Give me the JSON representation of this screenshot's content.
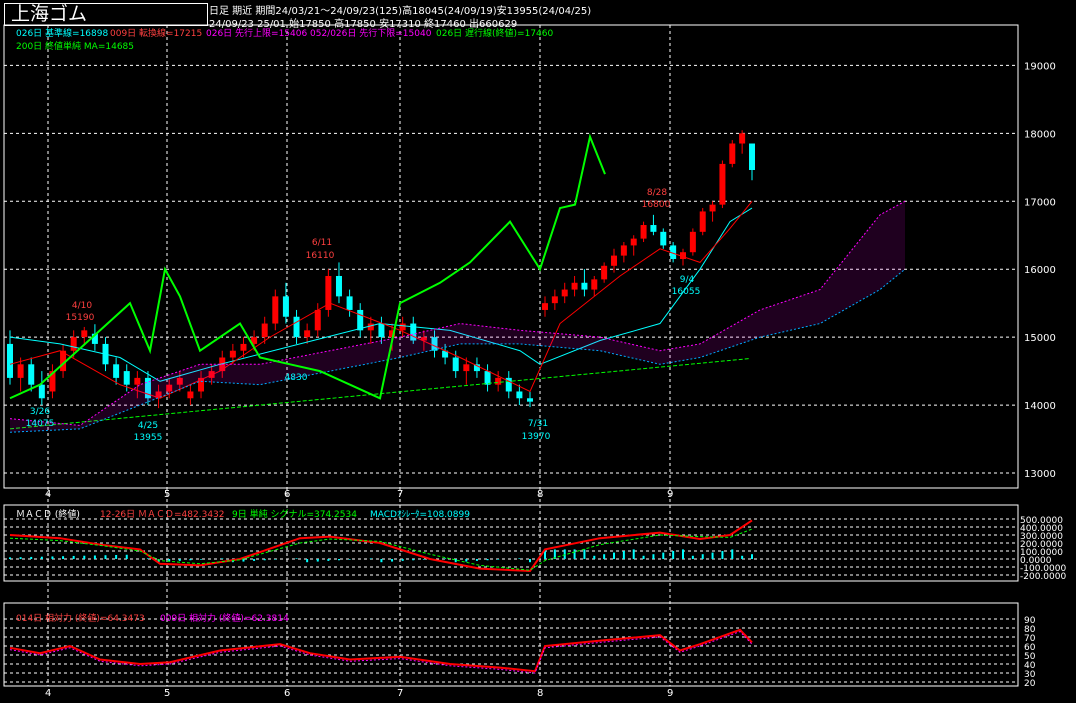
{
  "header": {
    "title": "上海ゴム",
    "line1": "日足  期近  期間24/03/21～24/09/23(125)高18045(24/09/19)安13955(24/04/25)",
    "line2": "24/09/23 25/01 始17850 高17850 安17310 終17460 出660629"
  },
  "legend": {
    "kijun": "026日 基準線=16898",
    "tenkan": "009日 転換線=17215",
    "senkou_a": "026日 先行上限=15406",
    "senkou_b": "052/026日 先行下限=15040",
    "chikou": "026日 遅行線(終値)=17460",
    "ma200": "200日 終値単純 MA=14685"
  },
  "macd_legend": {
    "title": "ＭＡＣＤ (終値)",
    "macd": "12-26日 ＭＡＣＤ=482.3432",
    "signal": "9日 単純 シグナル=374.2534",
    "osc": "MACDｵｼﾚｰﾀ=108.0899"
  },
  "rsi_legend": {
    "rsi14": "014日 相対力 (終値)=64.3473",
    "rsi9": "009日 相対力 (終値)=62.3814"
  },
  "colors": {
    "up": "#ff0000",
    "down": "#00ffff",
    "kijun": "#00ffff",
    "tenkan": "#ff0000",
    "chikou": "#00ff00",
    "ma200": "#00ff00",
    "cloud": "#ff00ff",
    "grid": "#ffffff"
  },
  "chart_data": [
    {
      "type": "candlestick",
      "ylim": [
        13000,
        19300
      ],
      "yticks": [
        13000,
        14000,
        15000,
        16000,
        17000,
        18000,
        19000
      ],
      "month_labels": [
        "4",
        "5",
        "6",
        "7",
        "8",
        "9"
      ],
      "candles": [
        [
          14900,
          15100,
          14300,
          14400
        ],
        [
          14400,
          14700,
          14200,
          14600
        ],
        [
          14600,
          14700,
          14200,
          14300
        ],
        [
          14300,
          14500,
          14000,
          14100
        ],
        [
          14200,
          14600,
          14100,
          14500
        ],
        [
          14500,
          14900,
          14400,
          14800
        ],
        [
          14800,
          15100,
          14700,
          15000
        ],
        [
          15000,
          15150,
          14900,
          15100
        ],
        [
          15050,
          15190,
          14800,
          14900
        ],
        [
          14900,
          15000,
          14500,
          14600
        ],
        [
          14600,
          14700,
          14300,
          14400
        ],
        [
          14500,
          14600,
          14200,
          14300
        ],
        [
          14300,
          14500,
          14100,
          14400
        ],
        [
          14400,
          14500,
          14000,
          14100
        ],
        [
          14100,
          14300,
          13955,
          14200
        ],
        [
          14200,
          14400,
          14100,
          14300
        ],
        [
          14300,
          14500,
          14200,
          14400
        ],
        [
          14100,
          14300,
          14000,
          14200
        ],
        [
          14200,
          14500,
          14100,
          14400
        ],
        [
          14400,
          14600,
          14300,
          14500
        ],
        [
          14500,
          14800,
          14400,
          14700
        ],
        [
          14700,
          14900,
          14600,
          14800
        ],
        [
          14800,
          15000,
          14700,
          14900
        ],
        [
          14900,
          15100,
          14800,
          15000
        ],
        [
          15000,
          15300,
          14900,
          15200
        ],
        [
          15200,
          15700,
          15100,
          15600
        ],
        [
          15600,
          15800,
          15200,
          15300
        ],
        [
          15300,
          15400,
          14900,
          15000
        ],
        [
          15000,
          15200,
          14900,
          15100
        ],
        [
          15100,
          15500,
          15000,
          15400
        ],
        [
          15400,
          16000,
          15300,
          15900
        ],
        [
          15900,
          16100,
          15500,
          15600
        ],
        [
          15600,
          15700,
          15300,
          15400
        ],
        [
          15400,
          15500,
          15000,
          15100
        ],
        [
          15100,
          15300,
          14900,
          15200
        ],
        [
          15200,
          15300,
          14900,
          15000
        ],
        [
          15000,
          15200,
          14800,
          15100
        ],
        [
          15100,
          15300,
          15000,
          15200
        ],
        [
          15200,
          15300,
          14900,
          14950
        ],
        [
          14950,
          15100,
          14800,
          15000
        ],
        [
          15000,
          15100,
          14700,
          14800
        ],
        [
          14800,
          14900,
          14600,
          14700
        ],
        [
          14700,
          14800,
          14400,
          14500
        ],
        [
          14500,
          14700,
          14300,
          14600
        ],
        [
          14600,
          14700,
          14400,
          14500
        ],
        [
          14500,
          14600,
          14200,
          14300
        ],
        [
          14300,
          14500,
          14200,
          14400
        ],
        [
          14400,
          14500,
          14100,
          14200
        ],
        [
          14200,
          14300,
          14000,
          14100
        ],
        [
          14100,
          14200,
          13970,
          14050
        ],
        [
          15400,
          15600,
          15300,
          15500
        ],
        [
          15500,
          15700,
          15400,
          15600
        ],
        [
          15600,
          15800,
          15500,
          15700
        ],
        [
          15700,
          15900,
          15600,
          15800
        ],
        [
          15800,
          16000,
          15600,
          15700
        ],
        [
          15700,
          15900,
          15600,
          15850
        ],
        [
          15850,
          16100,
          15800,
          16050
        ],
        [
          16050,
          16300,
          15950,
          16200
        ],
        [
          16200,
          16400,
          16100,
          16350
        ],
        [
          16350,
          16500,
          16200,
          16450
        ],
        [
          16450,
          16700,
          16400,
          16650
        ],
        [
          16650,
          16800,
          16500,
          16550
        ],
        [
          16550,
          16600,
          16300,
          16350
        ],
        [
          16350,
          16400,
          16100,
          16150
        ],
        [
          16150,
          16300,
          16055,
          16250
        ],
        [
          16250,
          16600,
          16200,
          16550
        ],
        [
          16550,
          16900,
          16500,
          16850
        ],
        [
          16850,
          17000,
          16700,
          16950
        ],
        [
          16950,
          17600,
          16900,
          17550
        ],
        [
          17550,
          17900,
          17500,
          17850
        ],
        [
          17850,
          18045,
          17700,
          18000
        ],
        [
          17850,
          17850,
          17310,
          17460
        ]
      ],
      "annotations": [
        "4/10",
        "15190",
        "4/25",
        "13955",
        "3/26",
        "14075",
        "6/11",
        "16110",
        "4830",
        "7/31",
        "13970",
        "8/28",
        "16800",
        "9/4",
        "16055"
      ]
    },
    {
      "type": "line",
      "name": "MACD",
      "ylim": [
        -200,
        500
      ],
      "yticks": [
        500,
        400,
        300,
        200,
        100,
        0,
        -100,
        -200
      ],
      "ytick_labels": [
        "500.0000",
        "400.0000",
        "300.0000",
        "200.0000",
        "100.0000",
        "0.0000",
        "-100.0000",
        "-200.0000"
      ]
    },
    {
      "type": "line",
      "name": "RSI",
      "ylim": [
        20,
        90
      ],
      "yticks": [
        90,
        80,
        70,
        60,
        50,
        40,
        30,
        20
      ]
    }
  ]
}
